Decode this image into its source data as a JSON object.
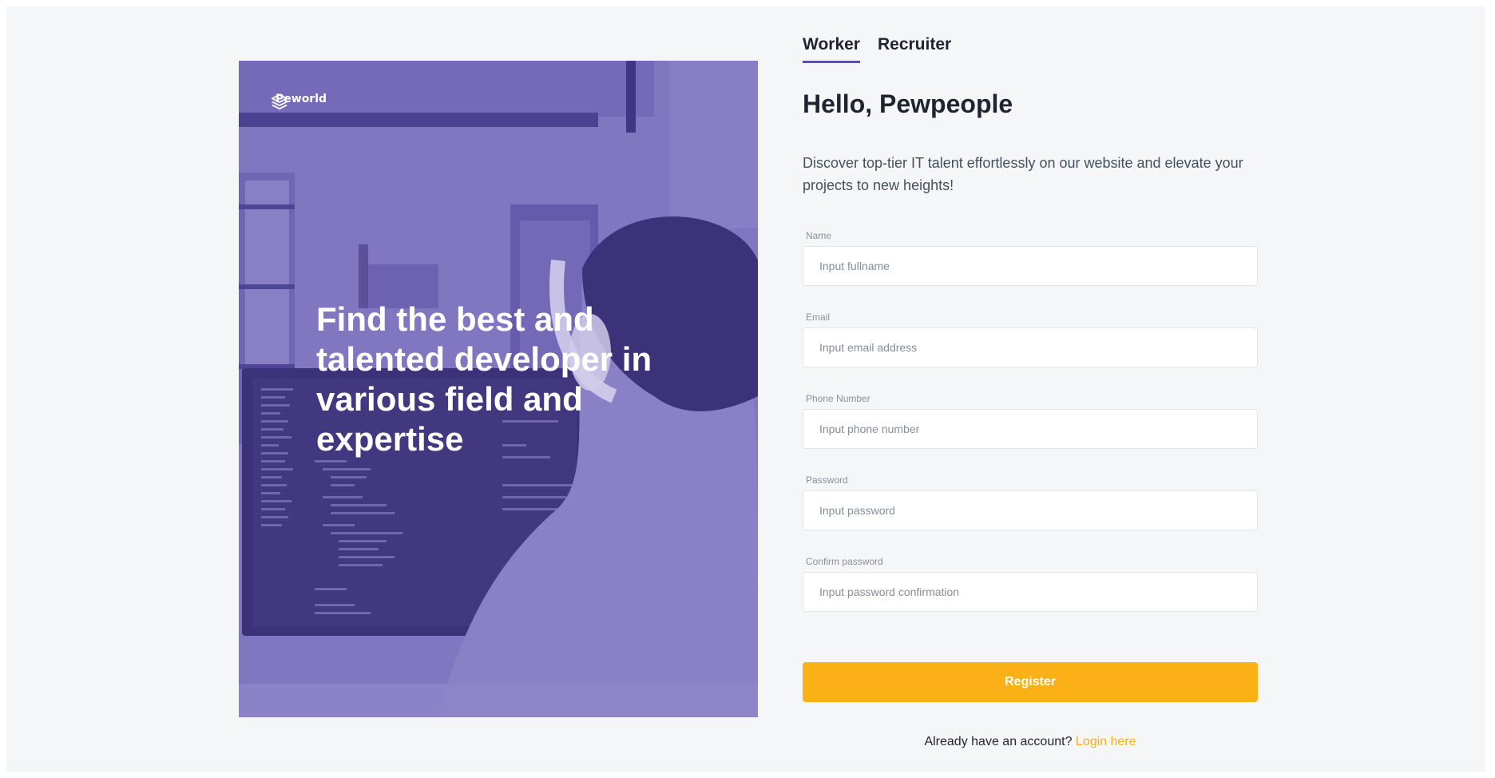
{
  "hero": {
    "brand": "Peworld",
    "brand_icon": "layers-icon",
    "headline": "Find the best and talented developer in various field and expertise"
  },
  "tabs": [
    {
      "label": "Worker",
      "active": true
    },
    {
      "label": "Recruiter",
      "active": false
    }
  ],
  "form": {
    "title": "Hello, Pewpeople",
    "subtitle": "Discover top-tier IT talent effortlessly on our website and elevate your projects to new heights!",
    "fields": [
      {
        "label": "Name",
        "placeholder": "Input fullname",
        "value": ""
      },
      {
        "label": "Email",
        "placeholder": "Input email address",
        "value": ""
      },
      {
        "label": "Phone Number",
        "placeholder": "Input phone number",
        "value": ""
      },
      {
        "label": "Password",
        "placeholder": "Input password",
        "value": ""
      },
      {
        "label": "Confirm password",
        "placeholder": "Input password confirmation",
        "value": ""
      }
    ],
    "register_label": "Register",
    "login_prompt": "Already have an account?",
    "login_link": "Login here"
  },
  "colors": {
    "primary": "#5e50a1",
    "accent": "#fbb017",
    "hero_overlay": "#7c6fbb",
    "background": "#f5f6f8"
  }
}
